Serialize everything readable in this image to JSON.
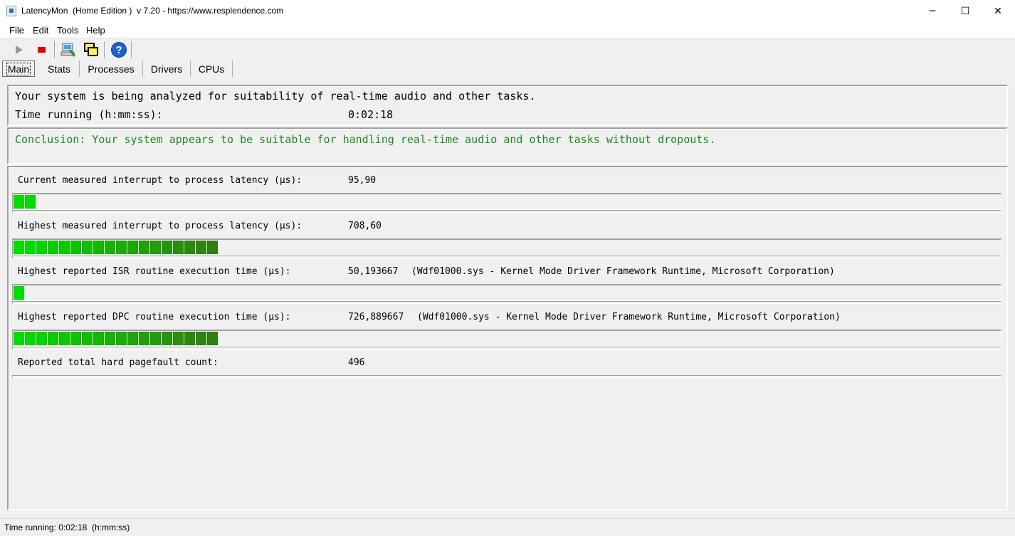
{
  "window": {
    "title": "LatencyMon  (Home Edition )  v 7.20 - https://www.resplendence.com",
    "controls": [
      "─",
      "☐",
      "✕"
    ]
  },
  "menu": [
    "File",
    "Edit",
    "Tools",
    "Help"
  ],
  "toolbar": {
    "buttons": [
      "play-icon",
      "stop-icon",
      "computer-icon",
      "windows-icon",
      "help-icon"
    ],
    "colors": {
      "stop": "#e00000",
      "help": "#1e5fd4"
    }
  },
  "tabs": [
    "Main",
    "Stats",
    "Processes",
    "Drivers",
    "CPUs"
  ],
  "analysis": {
    "status_line": "Your system is being analyzed for suitability of real-time audio and other tasks.",
    "time_label": "Time running (h:mm:ss):",
    "time_value": "0:02:18"
  },
  "conclusion": {
    "text": "Conclusion: Your system appears to be suitable for handling real-time audio and other tasks without dropouts.",
    "color": "#1a8a1a"
  },
  "metrics": [
    {
      "label": "Current measured interrupt to process latency (µs):",
      "value": "95,90",
      "detail": "",
      "level_segments": 2
    },
    {
      "label": "Highest measured interrupt to process latency (µs):",
      "value": "708,60",
      "detail": "",
      "level_segments": 18
    },
    {
      "label": "Highest reported ISR routine execution time (µs):",
      "value": "50,193667",
      "detail": "(Wdf01000.sys - Kernel Mode Driver Framework Runtime, Microsoft Corporation)",
      "level_segments": 1
    },
    {
      "label": "Highest reported DPC routine execution time (µs):",
      "value": "726,889667",
      "detail": "(Wdf01000.sys - Kernel Mode Driver Framework Runtime, Microsoft Corporation)",
      "level_segments": 18
    },
    {
      "label": "Reported total hard pagefault count:",
      "value": "496",
      "detail": "",
      "level_segments": null
    }
  ],
  "bar_colors": {
    "low": "#00e000",
    "high": "#2f7f0f"
  },
  "status_bar": "Time running: 0:02:18  (h:mm:ss)"
}
